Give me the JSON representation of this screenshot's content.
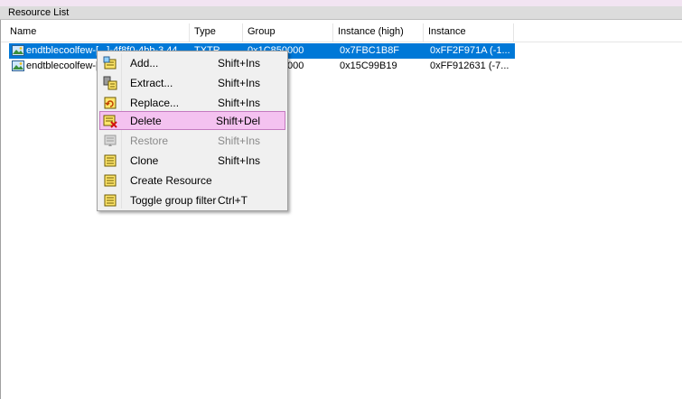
{
  "panel": {
    "title": "Resource List"
  },
  "columns": {
    "name": "Name",
    "type": "Type",
    "group": "Group",
    "instance_high": "Instance (high)",
    "instance": "Instance"
  },
  "rows": [
    {
      "name": "endtblecoolfew-[...]-4f8f0-4bb-3.44",
      "type": "TXTR",
      "group": "0x1C850000",
      "instance_high": "0x7FBC1B8F",
      "instance": "0xFF2F971A (-1...",
      "selected": true
    },
    {
      "name": "endtblecoolfew-[...]",
      "type": "",
      "group": "0x1C850000",
      "instance_high": "0x15C99B19",
      "instance": "0xFF912631 (-7...",
      "selected": false
    }
  ],
  "context_menu": {
    "items": [
      {
        "label": "Add...",
        "shortcut": "Shift+Ins",
        "icon": "add-icon"
      },
      {
        "label": "Extract...",
        "shortcut": "Shift+Ins",
        "icon": "extract-icon"
      },
      {
        "label": "Replace...",
        "shortcut": "Shift+Ins",
        "icon": "replace-icon"
      },
      {
        "label": "Delete",
        "shortcut": "Shift+Del",
        "icon": "delete-icon",
        "highlighted": true
      },
      {
        "label": "Restore",
        "shortcut": "Shift+Ins",
        "icon": "restore-icon",
        "disabled": true
      },
      {
        "label": "Clone",
        "shortcut": "Shift+Ins",
        "icon": "clone-icon"
      },
      {
        "label": "Create Resource",
        "shortcut": "",
        "icon": "create-resource-icon"
      },
      {
        "label": "Toggle group filter",
        "shortcut": "Ctrl+T",
        "icon": "toggle-filter-icon"
      }
    ]
  },
  "colors": {
    "selection": "#0078d7",
    "menu_highlight": "#f4c2f0",
    "menu_highlight_border": "#c47ac0",
    "disabled_text": "#8a8a8a"
  }
}
